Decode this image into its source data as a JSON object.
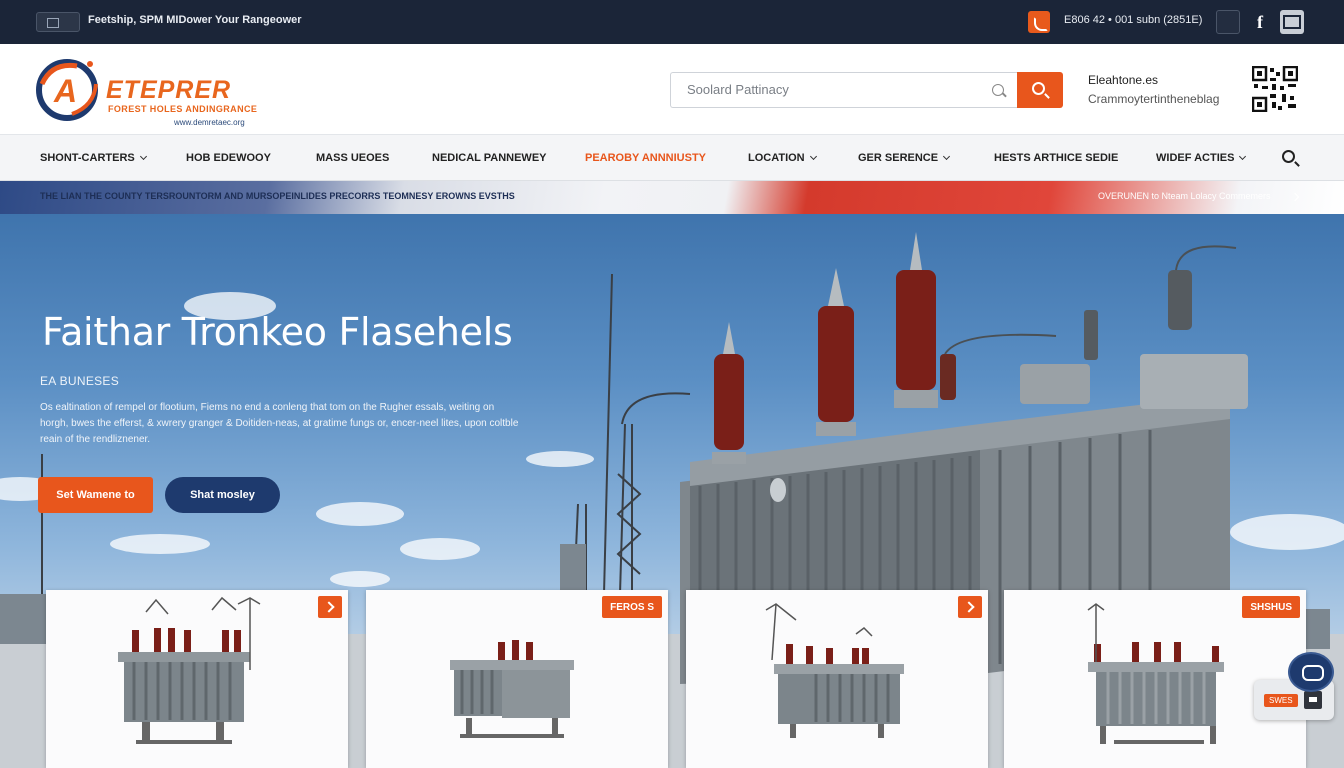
{
  "topbar": {
    "tagline": "Feetship, SPM MIDower Your Rangeower",
    "phone": "E806 42 • 001 subn (2851E)"
  },
  "header": {
    "logo_letter": "A",
    "logo_title": "ETEPRER",
    "logo_subtitle": "FOREST HOLES ANDINGRANCE",
    "logo_url": "www.demretaec.org",
    "search": {
      "placeholder": "Soolard Pattinacy"
    },
    "contact_line_1": "Eleahtone.es",
    "contact_line_2": "Crammoytertintheneblag"
  },
  "nav": {
    "items": [
      {
        "label": "SHONT-CARTERS",
        "dropdown": true
      },
      {
        "label": "HOB EDEWOOY",
        "dropdown": false
      },
      {
        "label": "MASS UEOES",
        "dropdown": false
      },
      {
        "label": "NEDICAL PANNEWEY",
        "dropdown": false
      },
      {
        "label": "PEAROBY ANNNIUSTY",
        "dropdown": false,
        "active": true
      },
      {
        "label": "LOCATION",
        "dropdown": true
      },
      {
        "label": "GER SERENCE",
        "dropdown": true
      },
      {
        "label": "HESTS ARTHICE SEDIE",
        "dropdown": false
      },
      {
        "label": "WIDEF ACTIES",
        "dropdown": true
      }
    ]
  },
  "ribbon": {
    "left_text": "THE LIAN THE COUNTY TERSROUNTORM AND MURSOPEINLIDES PRECORRS TEOMNESY EROWNS EVSTHS",
    "right_text": "OVERUNEN to Nteam Lolacy Commemers"
  },
  "hero": {
    "title": "Faithar Tronkeo Flasehels",
    "kicker": "EA BUNESES",
    "description": "Os ealtination of rempel or flootium, Fiems no end a conleng that tom on the Rugher essals, weiting on horgh, bwes the efferst, & xwrery granger & Doitiden-neas, at gratime fungs or, encer-neel lites, upon coltble reain of the rendliznener.",
    "primary_button": "Set Wamene to",
    "secondary_button": "Shat mosley"
  },
  "products": [
    {
      "tag": "",
      "tag_type": "arrow"
    },
    {
      "tag": "FEROS S",
      "tag_type": "label"
    },
    {
      "tag": "",
      "tag_type": "arrow"
    },
    {
      "tag": "SHSHUS",
      "tag_type": "label"
    }
  ],
  "chat": {
    "label": "SWES"
  },
  "colors": {
    "brand_orange": "#e8561c",
    "brand_navy": "#1e3a6e",
    "topbar_bg": "#1b2538"
  }
}
